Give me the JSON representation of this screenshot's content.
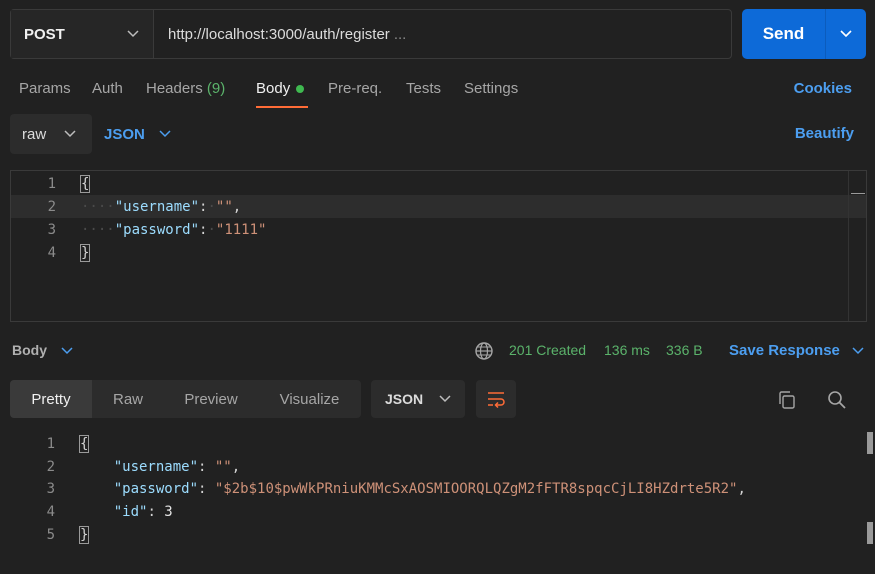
{
  "request": {
    "method": "POST",
    "url": "http://localhost:3000/auth/register",
    "url_ellipsis": "...",
    "send_label": "Send"
  },
  "request_tabs": {
    "params": "Params",
    "auth": "Auth",
    "headers": "Headers",
    "headers_count": "(9)",
    "body": "Body",
    "prereq": "Pre-req.",
    "tests": "Tests",
    "settings": "Settings",
    "cookies": "Cookies"
  },
  "body_mode": {
    "mode": "raw",
    "language": "JSON",
    "beautify": "Beautify"
  },
  "request_body": {
    "line_numbers": [
      "1",
      "2",
      "3",
      "4"
    ],
    "open_brace": "{",
    "username_key": "\"username\"",
    "username_value": "\"\"",
    "password_key": "\"password\"",
    "password_value": "\"1111\"",
    "close_brace": "}"
  },
  "response": {
    "body_label": "Body",
    "status": "201 Created",
    "time": "136 ms",
    "size": "336 B",
    "save_response": "Save Response",
    "tabs": [
      "Pretty",
      "Raw",
      "Preview",
      "Visualize"
    ],
    "format": "JSON",
    "line_numbers": [
      "1",
      "2",
      "3",
      "4",
      "5"
    ],
    "open_brace": "{",
    "username_key": "\"username\"",
    "username_value": "\"\"",
    "password_key": "\"password\"",
    "password_value": "\"$2b$10$pwWkPRniuKMMcSxAOSMIOORQLQZgM2fFTR8spqcCjLI8HZdrte5R2\"",
    "id_key": "\"id\"",
    "id_value": "3",
    "close_brace": "}"
  },
  "colors": {
    "accent": "#4c9ef0",
    "send": "#0d6ad8",
    "success": "#5bb36b",
    "active_tab": "#ff6c37"
  }
}
